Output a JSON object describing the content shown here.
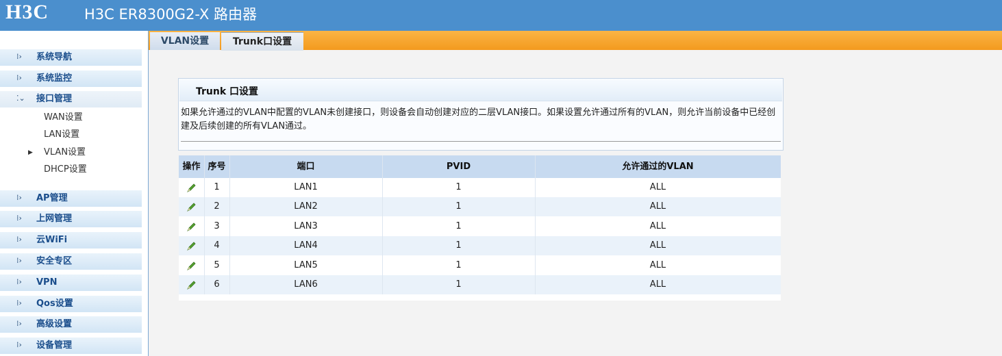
{
  "header": {
    "logo": "H3C",
    "title": "H3C ER8300G2-X 路由器"
  },
  "sidebar": {
    "items": [
      {
        "label": "系统导航"
      },
      {
        "label": "系统监控"
      },
      {
        "label": "接口管理",
        "expanded": true
      },
      {
        "label": "AP管理"
      },
      {
        "label": "上网管理"
      },
      {
        "label": "云WiFi"
      },
      {
        "label": "安全专区"
      },
      {
        "label": "VPN"
      },
      {
        "label": "Qos设置"
      },
      {
        "label": "高级设置"
      },
      {
        "label": "设备管理"
      }
    ],
    "submenu": [
      {
        "label": "WAN设置"
      },
      {
        "label": "LAN设置"
      },
      {
        "label": "VLAN设置",
        "current": true
      },
      {
        "label": "DHCP设置"
      }
    ]
  },
  "tabs": [
    {
      "label": "VLAN设置"
    },
    {
      "label": "Trunk口设置",
      "active": true
    }
  ],
  "panel": {
    "title": "Trunk 口设置",
    "description": "如果允许通过的VLAN中配置的VLAN未创建接口，则设备会自动创建对应的二层VLAN接口。如果设置允许通过所有的VLAN，则允许当前设备中已经创建及后续创建的所有VLAN通过。"
  },
  "table": {
    "columns": [
      "操作",
      "序号",
      "端口",
      "PVID",
      "允许通过的VLAN"
    ],
    "rows": [
      {
        "index": "1",
        "port": "LAN1",
        "pvid": "1",
        "vlan": "ALL"
      },
      {
        "index": "2",
        "port": "LAN2",
        "pvid": "1",
        "vlan": "ALL"
      },
      {
        "index": "3",
        "port": "LAN3",
        "pvid": "1",
        "vlan": "ALL"
      },
      {
        "index": "4",
        "port": "LAN4",
        "pvid": "1",
        "vlan": "ALL"
      },
      {
        "index": "5",
        "port": "LAN5",
        "pvid": "1",
        "vlan": "ALL"
      },
      {
        "index": "6",
        "port": "LAN6",
        "pvid": "1",
        "vlan": "ALL"
      }
    ],
    "row_icon": "edit-pencil-icon"
  },
  "colors": {
    "header_bg": "#4b8fcd",
    "tabbar_orange": "#f39a1e",
    "table_header": "#c7daf0",
    "menu_text": "#1b4e8c"
  }
}
